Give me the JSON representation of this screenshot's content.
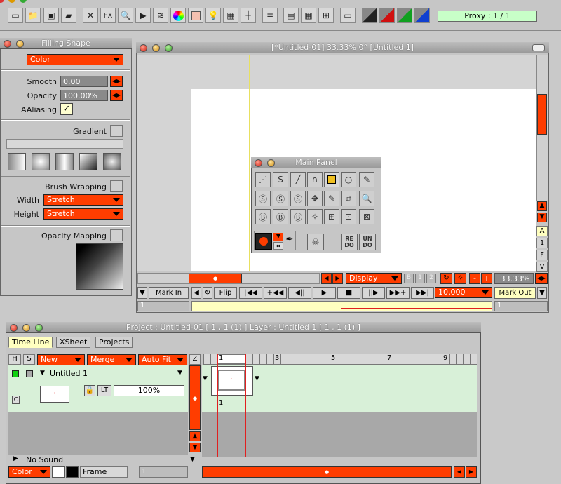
{
  "toolbar": {
    "fx_label": "FX",
    "proxy_label": "Proxy : 1 / 1"
  },
  "filling_shape": {
    "title": "Filling Shape",
    "mode": "Color",
    "smooth_label": "Smooth",
    "smooth_value": "0.00",
    "opacity_label": "Opacity",
    "opacity_value": "100.00%",
    "aaliasing_label": "AAliasing",
    "gradient_label": "Gradient",
    "brush_wrapping_label": "Brush Wrapping",
    "width_label": "Width",
    "width_value": "Stretch",
    "height_label": "Height",
    "height_value": "Stretch",
    "opacity_mapping_label": "Opacity Mapping"
  },
  "viewer": {
    "title": "[*Untitled-01]  33.33%   0°  [Untitled 1]",
    "side_letters": [
      "A",
      "1",
      "F",
      "V"
    ],
    "display_label": "Display",
    "b_label": "B",
    "one_label": "1",
    "two_label": "2",
    "minus_label": "-",
    "plus_label": "+",
    "zoom_value": "33.33%",
    "mark_in_label": "Mark In",
    "flip_label": "Flip",
    "fps_value": "10.000",
    "mark_out_label": "Mark Out",
    "frame_start": "1",
    "frame_end": "1"
  },
  "main_panel": {
    "title": "Main Panel",
    "redo_label": "RE DO",
    "undo_label": "UN DO"
  },
  "project": {
    "title": "Project : Untitled-01 [ 1 , 1  (1) ]        Layer : Untitled 1 [ 1 , 1  (1) ]",
    "tabs": [
      "Time Line",
      "XSheet",
      "Projects"
    ],
    "col_h": "H",
    "col_s": "S",
    "new_label": "New",
    "merge_label": "Merge",
    "autofit_label": "Auto Fit",
    "z_label": "Z",
    "ruler_labels": [
      "1",
      "3",
      "5",
      "7",
      "9"
    ],
    "layer_name": "Untitled 1",
    "c_label": "C",
    "lt_label": "LT",
    "opacity_value": "100%",
    "cell_frame_label": "1",
    "no_sound_label": "No Sound",
    "color_mode": "Color",
    "frame_label": "Frame",
    "frame_value": "1"
  }
}
